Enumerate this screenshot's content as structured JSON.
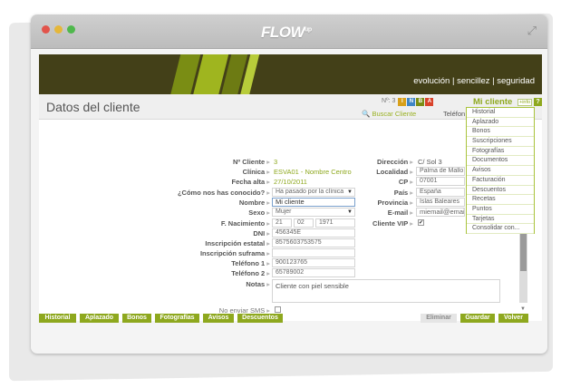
{
  "window": {
    "logo": "FLOW",
    "logo_sup": "up"
  },
  "banner": {
    "slogan": "evolución | sencillez | seguridad"
  },
  "header": {
    "title": "Datos del cliente",
    "num_label": "Nº: 3",
    "badges": [
      {
        "letter": "I",
        "color": "#d8a01a"
      },
      {
        "letter": "N",
        "color": "#3f86c6"
      },
      {
        "letter": "B",
        "color": "#7a8d14"
      },
      {
        "letter": "A",
        "color": "#d9432b"
      }
    ],
    "buscar": "Buscar Cliente",
    "telefono": "Teléfon",
    "mi_cliente": "Mi cliente",
    "info": "+info",
    "help": "?"
  },
  "menu": [
    "Historial",
    "Aplazado",
    "Bonos",
    "Suscripciones",
    "Fotografías",
    "Documentos",
    "Avisos",
    "Facturación",
    "Descuentos",
    "Recetas",
    "Puntos",
    "Tarjetas",
    "Consolidar con..."
  ],
  "form": {
    "n_cliente": {
      "label": "Nº Cliente",
      "value": "3"
    },
    "clinica": {
      "label": "Clínica",
      "value": "ESVA01 - Nombre Centro"
    },
    "fecha_alta": {
      "label": "Fecha alta",
      "value": "27/10/2011"
    },
    "como": {
      "label": "¿Cómo nos has conocido?",
      "value": "Ha pasado por la clínica"
    },
    "nombre": {
      "label": "Nombre",
      "value": "Mi cliente"
    },
    "sexo": {
      "label": "Sexo",
      "value": "Mujer"
    },
    "nacimiento": {
      "label": "F. Nacimiento",
      "day": "21",
      "month": "02",
      "year": "1971"
    },
    "dni": {
      "label": "DNI",
      "value": "456345E"
    },
    "ins_estatal": {
      "label": "Inscripción estatal",
      "value": "8575603753575"
    },
    "ins_suframa": {
      "label": "Inscripción suframa",
      "value": ""
    },
    "tel1": {
      "label": "Teléfono 1",
      "value": "900123765"
    },
    "tel2": {
      "label": "Teléfono 2",
      "value": "65789002"
    },
    "notas": {
      "label": "Notas",
      "value": "Cliente con piel sensible"
    },
    "sms": {
      "label": "No enviar SMS"
    },
    "direccion": {
      "label": "Dirección",
      "value": "C/ Sol 3"
    },
    "localidad": {
      "label": "Localidad",
      "value": "Palma de Mallo"
    },
    "cp": {
      "label": "CP",
      "value": "07001"
    },
    "pais": {
      "label": "País",
      "value": "España"
    },
    "provincia": {
      "label": "Provincia",
      "value": "Islas Baleares"
    },
    "email": {
      "label": "E-mail",
      "value": "miemail@email"
    },
    "vip": {
      "label": "Cliente VIP",
      "checked": "✔"
    }
  },
  "buttons": {
    "left": [
      "Historial",
      "Aplazado",
      "Bonos",
      "Fotografías",
      "Avisos",
      "Descuentos"
    ],
    "eliminar": "Eliminar",
    "guardar": "Guardar",
    "volver": "Volver"
  }
}
